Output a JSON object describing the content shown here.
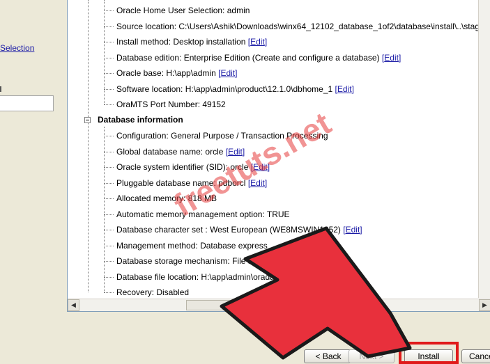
{
  "left_nav": {
    "link_text": "Selection"
  },
  "summary": {
    "install_rows": [
      {
        "text": "Oracle Home User Selection: admin",
        "edit": ""
      },
      {
        "text": "Source location: C:\\Users\\Ashik\\Downloads\\winx64_12102_database_1of2\\database\\install\\..\\stag",
        "edit": ""
      },
      {
        "text": "Install method: Desktop installation",
        "edit": "Edit"
      },
      {
        "text": "Database edition: Enterprise Edition (Create and configure a database)",
        "edit": "Edit"
      },
      {
        "text": "Oracle base: H:\\app\\admin",
        "edit": "Edit"
      },
      {
        "text": "Software location: H:\\app\\admin\\product\\12.1.0\\dbhome_1",
        "edit": "Edit"
      },
      {
        "text": "OraMTS Port Number: 49152",
        "edit": ""
      }
    ],
    "db_section_title": "Database information",
    "db_rows": [
      {
        "text": "Configuration: General Purpose / Transaction Processing",
        "edit": ""
      },
      {
        "text": "Global database name: orcle",
        "edit": "Edit"
      },
      {
        "text": "Oracle system identifier (SID): orcle",
        "edit": "Edit"
      },
      {
        "text": "Pluggable database name: pdborcl",
        "edit": "Edit"
      },
      {
        "text": "Allocated memory: 818 MB",
        "edit": ""
      },
      {
        "text": "Automatic memory management option: TRUE",
        "edit": ""
      },
      {
        "text": "Database character set : West European (WE8MSWIN1252)",
        "edit": "Edit"
      },
      {
        "text": "Management method: Database express",
        "edit": ""
      },
      {
        "text": "Database storage mechanism: File system",
        "edit": ""
      },
      {
        "text": "Database file location: H:\\app\\admin\\oradata",
        "edit": ""
      },
      {
        "text": "Recovery: Disabled",
        "edit": ""
      }
    ]
  },
  "buttons": {
    "back": "< Back",
    "next": "Next >",
    "install": "Install",
    "cancel": "Cancel"
  },
  "watermark": "freetuts.net",
  "colors": {
    "highlight": "#e01a1a",
    "arrow_fill": "#e8303c",
    "link": "#1a1aa6"
  }
}
